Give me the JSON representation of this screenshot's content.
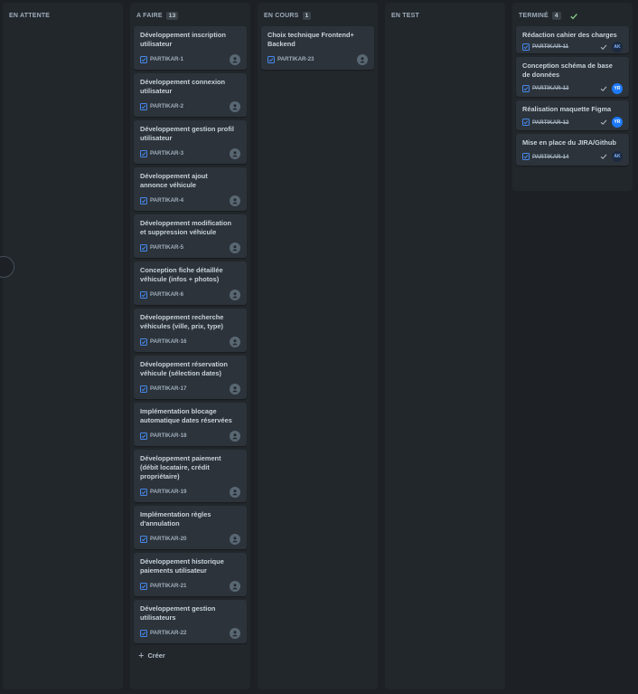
{
  "colors": {
    "background": "#1d2125",
    "column": "#22272b",
    "card": "#2c333a",
    "task_icon": "#4688ec",
    "done_check": "#8ed08e",
    "avatar_blue": "#1d7afc",
    "avatar_ak": "#1c2b41"
  },
  "columns": [
    {
      "title": "EN ATTENTE",
      "count": "",
      "cards": []
    },
    {
      "title": "A FAIRE",
      "count": "13",
      "create_label": "Créer",
      "cards": [
        {
          "title": "Développement inscription utilisateur",
          "key": "PARTIKAR-1"
        },
        {
          "title": "Développement connexion utilisateur",
          "key": "PARTIKAR-2"
        },
        {
          "title": "Développement gestion profil utilisateur",
          "key": "PARTIKAR-3"
        },
        {
          "title": "Développement ajout annonce véhicule",
          "key": "PARTIKAR-4"
        },
        {
          "title": "Développement modification et suppression véhicule",
          "key": "PARTIKAR-5"
        },
        {
          "title": "Conception fiche détaillée véhicule (infos + photos)",
          "key": "PARTIKAR-6"
        },
        {
          "title": "Développement recherche véhicules (ville, prix, type)",
          "key": "PARTIKAR-16"
        },
        {
          "title": "Développement réservation véhicule (sélection dates)",
          "key": "PARTIKAR-17"
        },
        {
          "title": "Implémentation blocage automatique dates réservées",
          "key": "PARTIKAR-18"
        },
        {
          "title": "Développement paiement (débit locataire, crédit propriétaire)",
          "key": "PARTIKAR-19"
        },
        {
          "title": "Implémentation règles d'annulation",
          "key": "PARTIKAR-20"
        },
        {
          "title": "Développement historique paiements utilisateur",
          "key": "PARTIKAR-21"
        },
        {
          "title": "Développement gestion utilisateurs",
          "key": "PARTIKAR-22"
        }
      ]
    },
    {
      "title": "EN COURS",
      "count": "1",
      "cards": [
        {
          "title": "Choix technique Frontend+ Backend",
          "key": "PARTIKAR-23"
        }
      ]
    },
    {
      "title": "EN TEST",
      "count": "",
      "cards": []
    },
    {
      "title": "TERMINÉ",
      "count": "4",
      "cards": [
        {
          "title": "Rédaction cahier des charges",
          "key": "PARTIKAR-11",
          "assignee": "AK"
        },
        {
          "title": "Conception schéma de base de données",
          "key": "PARTIKAR-13",
          "assignee": "YR"
        },
        {
          "title": "Réalisation maquette Figma",
          "key": "PARTIKAR-12",
          "assignee": "YR"
        },
        {
          "title": "Mise en place du JIRA/Github",
          "key": "PARTIKAR-14",
          "assignee": "AK"
        }
      ]
    }
  ]
}
